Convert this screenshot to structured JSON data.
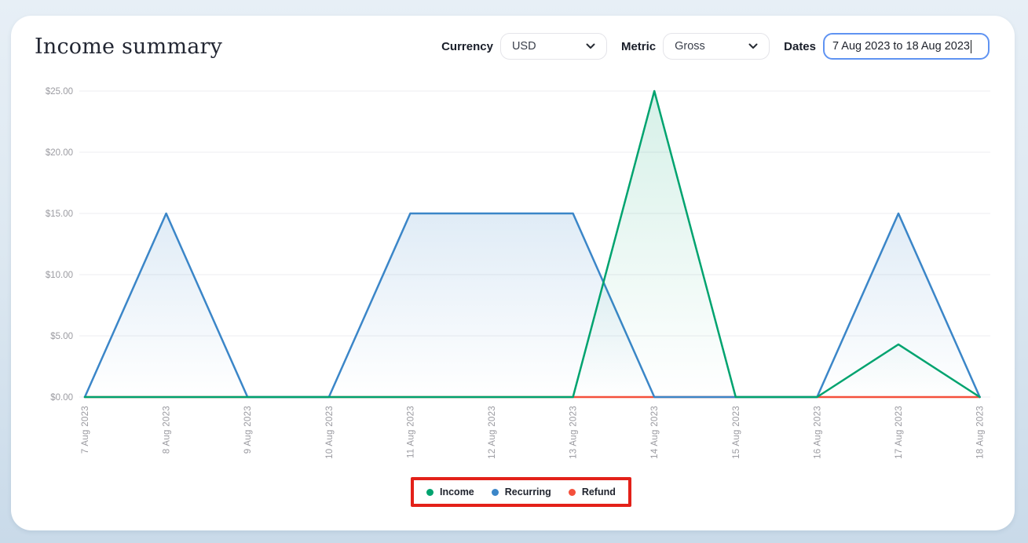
{
  "header": {
    "title": "Income summary"
  },
  "controls": {
    "currency": {
      "label": "Currency",
      "value": "USD",
      "icon": "chevron-down-icon"
    },
    "metric": {
      "label": "Metric",
      "value": "Gross",
      "icon": "chevron-down-icon"
    },
    "dates": {
      "label": "Dates",
      "value": "7 Aug 2023 to 18 Aug 2023",
      "caret_visible": true,
      "focus_border_color": "#5f93f2"
    }
  },
  "chart_data": {
    "type": "line",
    "title": "Income summary",
    "x": [
      "7 Aug 2023",
      "8 Aug 2023",
      "9 Aug 2023",
      "10 Aug 2023",
      "11 Aug 2023",
      "12 Aug 2023",
      "13 Aug 2023",
      "14 Aug 2023",
      "15 Aug 2023",
      "16 Aug 2023",
      "17 Aug 2023",
      "18 Aug 2023"
    ],
    "series": [
      {
        "name": "Income",
        "color": "#00a36f",
        "values": [
          0,
          0,
          0,
          0,
          0,
          0,
          0,
          25,
          0,
          0,
          4.3,
          0
        ]
      },
      {
        "name": "Recurring",
        "color": "#3b86c8",
        "values": [
          0,
          15,
          0,
          0,
          15,
          15,
          15,
          0,
          0,
          0,
          15,
          0
        ]
      },
      {
        "name": "Refund",
        "color": "#f4503c",
        "values": [
          0,
          0,
          0,
          0,
          0,
          0,
          0,
          0,
          0,
          0,
          0,
          0
        ]
      }
    ],
    "y_ticks": [
      "$0.00",
      "$5.00",
      "$10.00",
      "$15.00",
      "$20.00",
      "$25.00"
    ],
    "ylim": [
      0,
      25
    ],
    "grid": "horizontal",
    "x_label_rotation": -90,
    "legend_position": "bottom",
    "area_fill": "gradient-fade-to-bottom"
  },
  "annotation": {
    "type": "highlight-rectangle",
    "target": "legend",
    "color": "#e32119"
  }
}
